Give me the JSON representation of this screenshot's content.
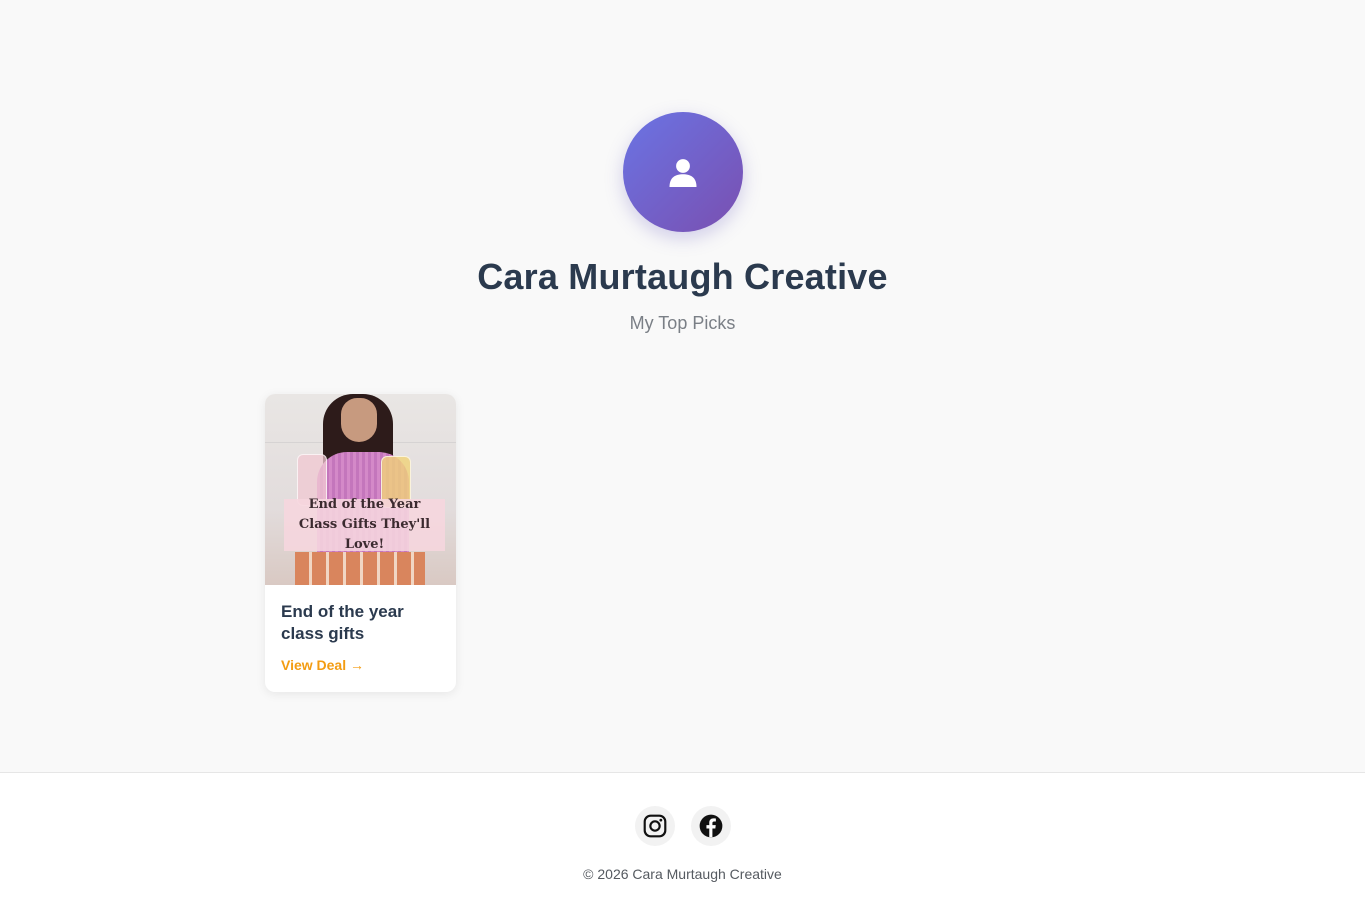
{
  "profile": {
    "title": "Cara Murtaugh Creative",
    "subtitle": "My Top Picks",
    "avatar_icon": "user-icon",
    "avatar_colors": [
      "#6a74e4",
      "#7a4fb0"
    ]
  },
  "products": [
    {
      "image_caption": "End of the Year Class Gifts They'll Love!",
      "title": "End of the year class gifts",
      "link_label": "View Deal →",
      "link_color": "#f39c12"
    }
  ],
  "footer": {
    "social": [
      {
        "name": "instagram",
        "icon": "instagram-icon"
      },
      {
        "name": "facebook",
        "icon": "facebook-icon"
      }
    ],
    "copyright": "© 2026 Cara Murtaugh Creative"
  },
  "colors": {
    "background": "#f9f9f9",
    "title": "#2b3a4e",
    "accent": "#f39c12"
  }
}
